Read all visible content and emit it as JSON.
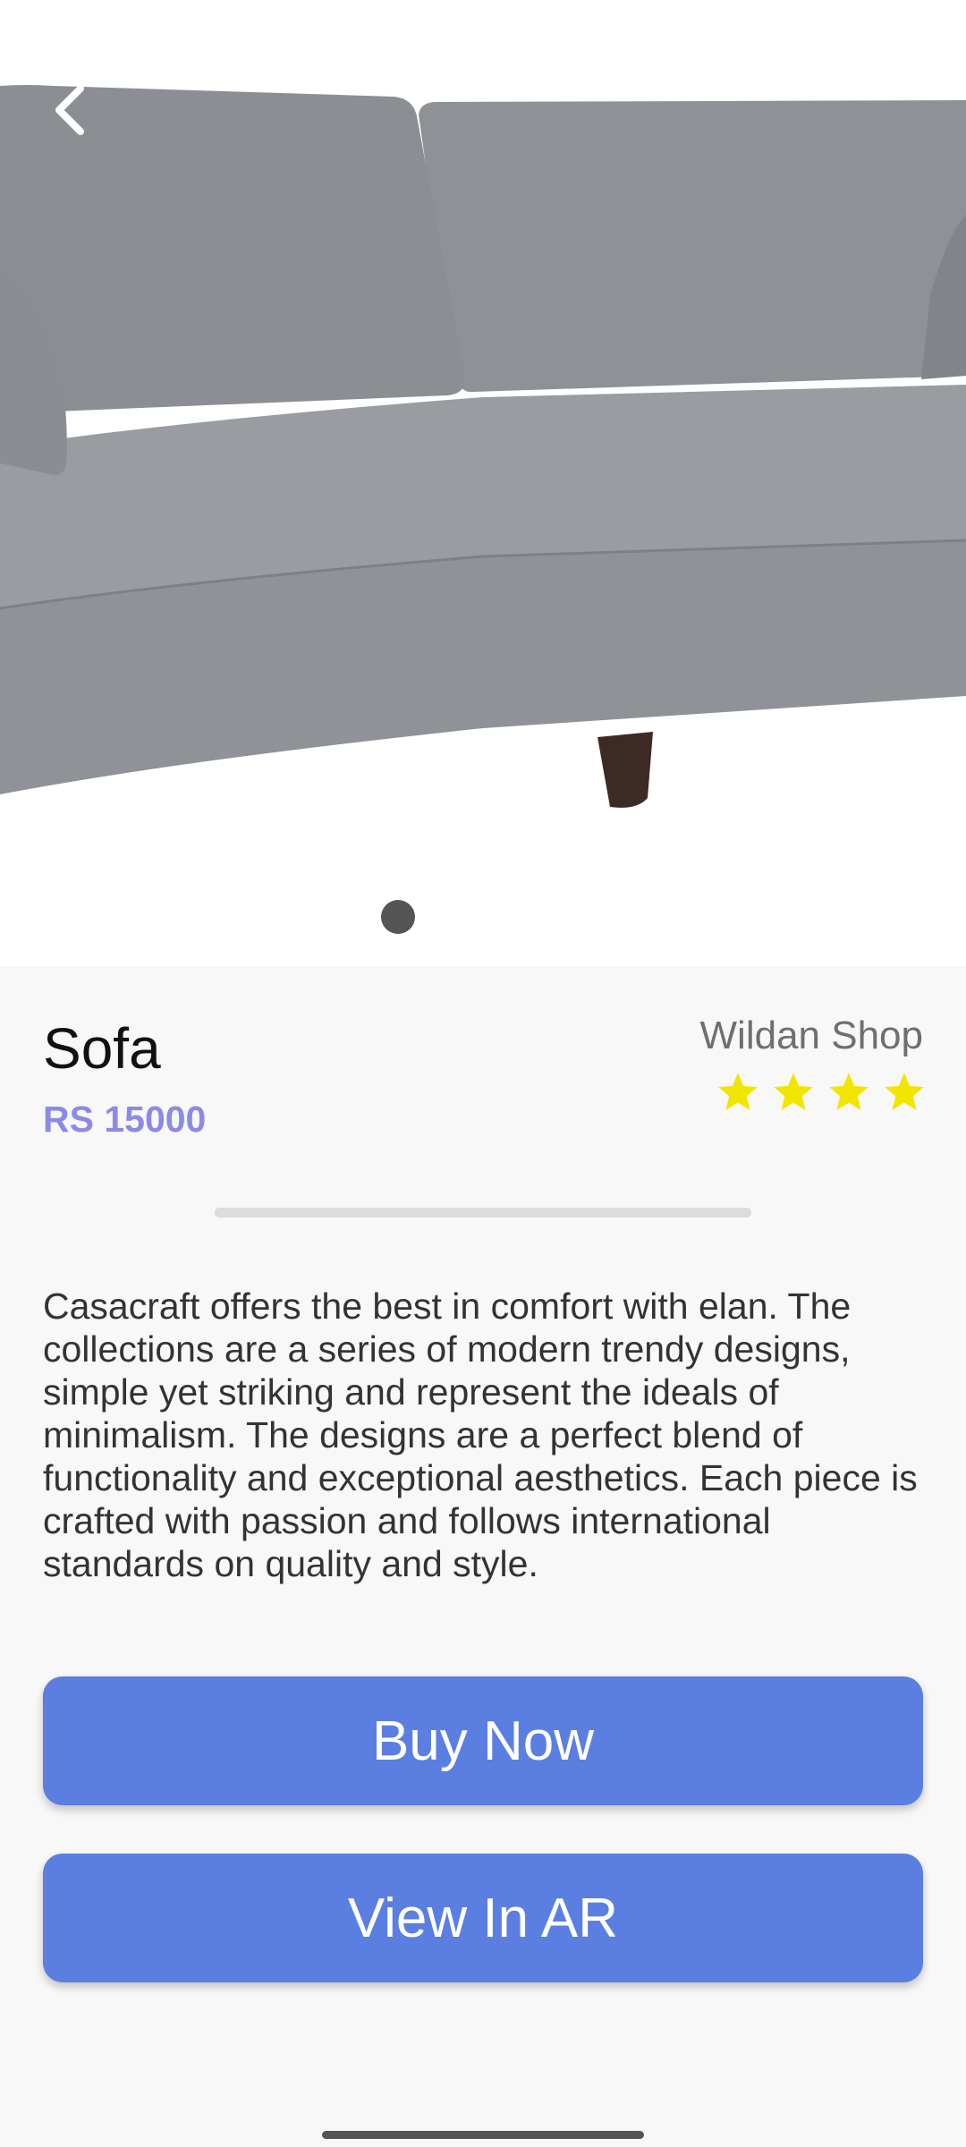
{
  "product": {
    "title": "Sofa",
    "price": "RS 15000",
    "shop": "Wildan Shop",
    "rating": 4,
    "description": " Casacraft offers the best in comfort with elan. The collections are a series of modern trendy designs, simple yet striking and represent the ideals of minimalism. The designs are a perfect blend of functionality and exceptional aesthetics. Each piece is crafted with passion and follows international standards on quality and style."
  },
  "gallery": {
    "image_icon": "sofa-image",
    "page_count": 1,
    "active_index": 0
  },
  "nav": {
    "back_icon": "chevron-left-icon"
  },
  "actions": {
    "buy_label": "Buy Now",
    "ar_label": "View In AR"
  },
  "colors": {
    "accent": "#5b7fe0",
    "price": "#8b8be6",
    "star": "#f2e600"
  }
}
